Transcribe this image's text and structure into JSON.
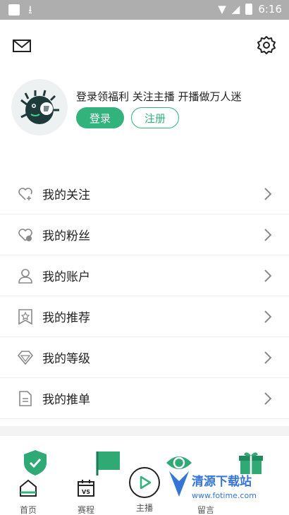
{
  "statusbar": {
    "time": "6:16"
  },
  "profile": {
    "slogan": "登录领福利 关注主播 开播做万人迷",
    "login_label": "登录",
    "register_label": "注册"
  },
  "menu": {
    "items": [
      {
        "label": "我的关注",
        "icon": "heart-plus-icon"
      },
      {
        "label": "我的粉丝",
        "icon": "heart-fans-icon"
      },
      {
        "label": "我的账户",
        "icon": "user-icon"
      },
      {
        "label": "我的推荐",
        "icon": "bookmark-star-icon"
      },
      {
        "label": "我的等级",
        "icon": "diamond-icon"
      },
      {
        "label": "我的推单",
        "icon": "document-icon"
      }
    ]
  },
  "tabbar": {
    "tabs": [
      {
        "label": "首页",
        "icon": "home-icon"
      },
      {
        "label": "赛程",
        "icon": "schedule-vs-icon"
      },
      {
        "label": "主播",
        "icon": "play-icon"
      },
      {
        "label": "留言",
        "icon": "message-icon"
      }
    ]
  },
  "watermark": {
    "title": "清源下载站",
    "url": "www.fotime.com"
  },
  "colors": {
    "accent": "#33b37c",
    "statusbar": "#aeaeae"
  }
}
